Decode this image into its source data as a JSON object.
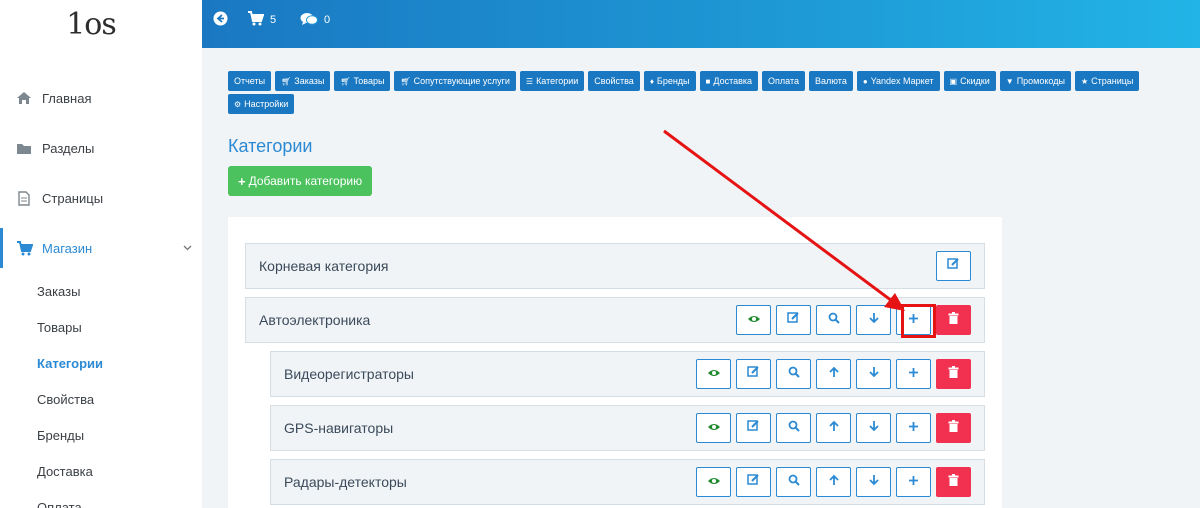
{
  "logo": {
    "text": "1os"
  },
  "header": {
    "back_label": "",
    "cart_count": "5",
    "messages_count": "0"
  },
  "sidebar": {
    "items": [
      {
        "label": "Главная",
        "icon": "home-icon"
      },
      {
        "label": "Разделы",
        "icon": "folder-icon"
      },
      {
        "label": "Страницы",
        "icon": "file-icon"
      },
      {
        "label": "Магазин",
        "icon": "cart-icon"
      }
    ],
    "shop_sub": [
      "Заказы",
      "Товары",
      "Категории",
      "Свойства",
      "Бренды",
      "Доставка",
      "Оплата"
    ]
  },
  "tabs": [
    {
      "label": "Отчеты",
      "icon": ""
    },
    {
      "label": "Заказы",
      "icon": "cart-icon"
    },
    {
      "label": "Товары",
      "icon": "cart-icon"
    },
    {
      "label": "Сопутствующие услуги",
      "icon": "cart-icon"
    },
    {
      "label": "Категории",
      "icon": "list-icon"
    },
    {
      "label": "Свойства",
      "icon": ""
    },
    {
      "label": "Бренды",
      "icon": "bell-icon"
    },
    {
      "label": "Доставка",
      "icon": "truck-icon"
    },
    {
      "label": "Оплата",
      "icon": ""
    },
    {
      "label": "Валюта",
      "icon": ""
    },
    {
      "label": "Yandex Маркет",
      "icon": "user-icon"
    },
    {
      "label": "Скидки",
      "icon": "gift-icon"
    },
    {
      "label": "Промокоды",
      "icon": "trophy-icon"
    },
    {
      "label": "Страницы",
      "icon": "star-icon"
    },
    {
      "label": "Настройки",
      "icon": "gear-icon"
    }
  ],
  "page": {
    "title": "Категории",
    "add_button": "Добавить категорию"
  },
  "categories": [
    {
      "name": "Корневая категория"
    },
    {
      "name": "Автоэлектроника"
    },
    {
      "name": "Видеорегистраторы"
    },
    {
      "name": "GPS-навигаторы"
    },
    {
      "name": "Радары-детекторы"
    }
  ],
  "colors": {
    "primary": "#1a78c2",
    "accent": "#2b8ad3",
    "success": "#4cc25e",
    "danger": "#f2304f",
    "annotation": "#e51313"
  }
}
